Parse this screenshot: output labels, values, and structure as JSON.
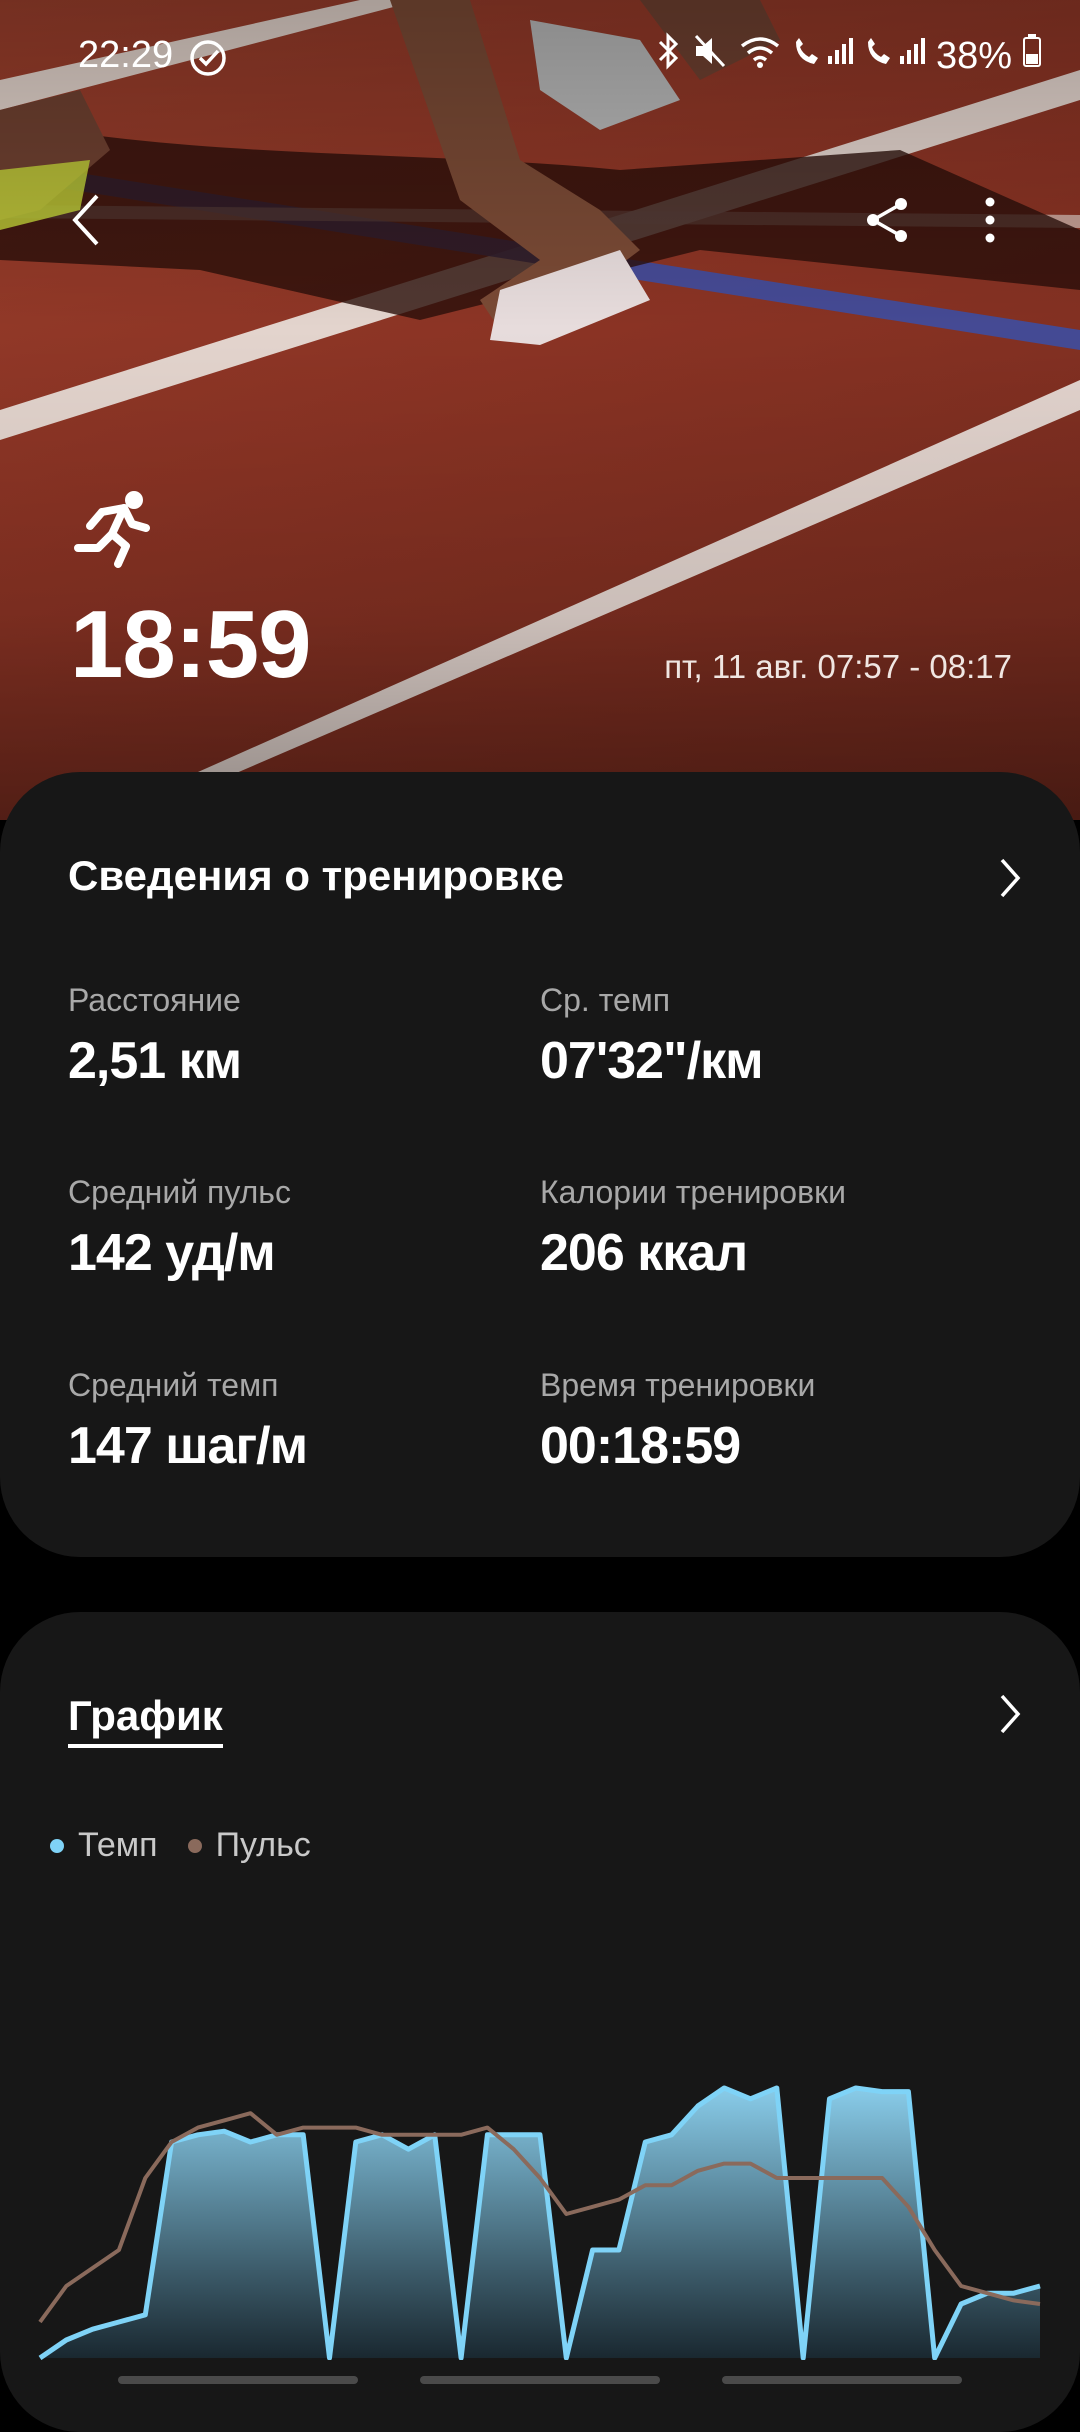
{
  "status_bar": {
    "time": "22:29",
    "battery": "38%"
  },
  "hero": {
    "duration": "18:59",
    "date_range": "пт, 11 авг. 07:57 - 08:17"
  },
  "workout_details": {
    "title": "Сведения о тренировке",
    "metrics": [
      {
        "label": "Расстояние",
        "value": "2,51 км"
      },
      {
        "label": "Ср. темп",
        "value": "07'32\"/км"
      },
      {
        "label": "Средний пульс",
        "value": "142 уд/м"
      },
      {
        "label": "Калории тренировки",
        "value": "206 ккал"
      },
      {
        "label": "Средний темп",
        "value": "147 шаг/м"
      },
      {
        "label": "Время тренировки",
        "value": "00:18:59"
      }
    ]
  },
  "graph": {
    "title": "График",
    "legend": [
      {
        "label": "Темп",
        "color": "#7fd3f7"
      },
      {
        "label": "Пульс",
        "color": "#8a6a5c"
      }
    ]
  },
  "chart_data": {
    "type": "line",
    "series": [
      {
        "name": "Темп",
        "values": [
          0,
          5,
          8,
          10,
          12,
          60,
          62,
          63,
          60,
          62,
          62,
          0,
          60,
          62,
          58,
          62,
          0,
          62,
          62,
          62,
          0,
          30,
          30,
          60,
          62,
          70,
          75,
          72,
          75,
          0,
          72,
          75,
          74,
          74,
          0,
          15,
          18,
          18,
          20
        ]
      },
      {
        "name": "Пульс",
        "values": [
          10,
          20,
          25,
          30,
          50,
          60,
          64,
          66,
          68,
          62,
          64,
          64,
          64,
          62,
          62,
          62,
          62,
          64,
          58,
          50,
          40,
          42,
          44,
          48,
          48,
          52,
          54,
          54,
          50,
          50,
          50,
          50,
          50,
          42,
          30,
          20,
          18,
          16,
          15
        ]
      }
    ]
  }
}
